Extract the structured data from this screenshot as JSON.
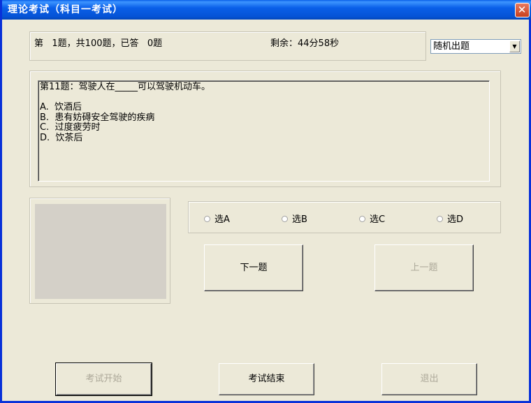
{
  "window": {
    "title": "理论考试（科目一考试）",
    "close_glyph": "✕"
  },
  "status": {
    "progress_text": "第   1题，共100题，已答   0题",
    "remaining_text": "剩余：44分58秒"
  },
  "mode_select": {
    "selected": "随机出题",
    "arrow": "▼"
  },
  "question": {
    "lines": [
      "第11题：驾驶人在_____可以驾驶机动车。",
      "",
      "A.  饮酒后",
      "B.  患有妨碍安全驾驶的疾病",
      "C.  过度疲劳时",
      "D.  饮茶后"
    ]
  },
  "options": [
    {
      "label": "选A"
    },
    {
      "label": "选B"
    },
    {
      "label": "选C"
    },
    {
      "label": "选D"
    }
  ],
  "buttons": {
    "next": "下一题",
    "prev": "上一题",
    "start": "考试开始",
    "end": "考试结束",
    "exit": "退出"
  }
}
